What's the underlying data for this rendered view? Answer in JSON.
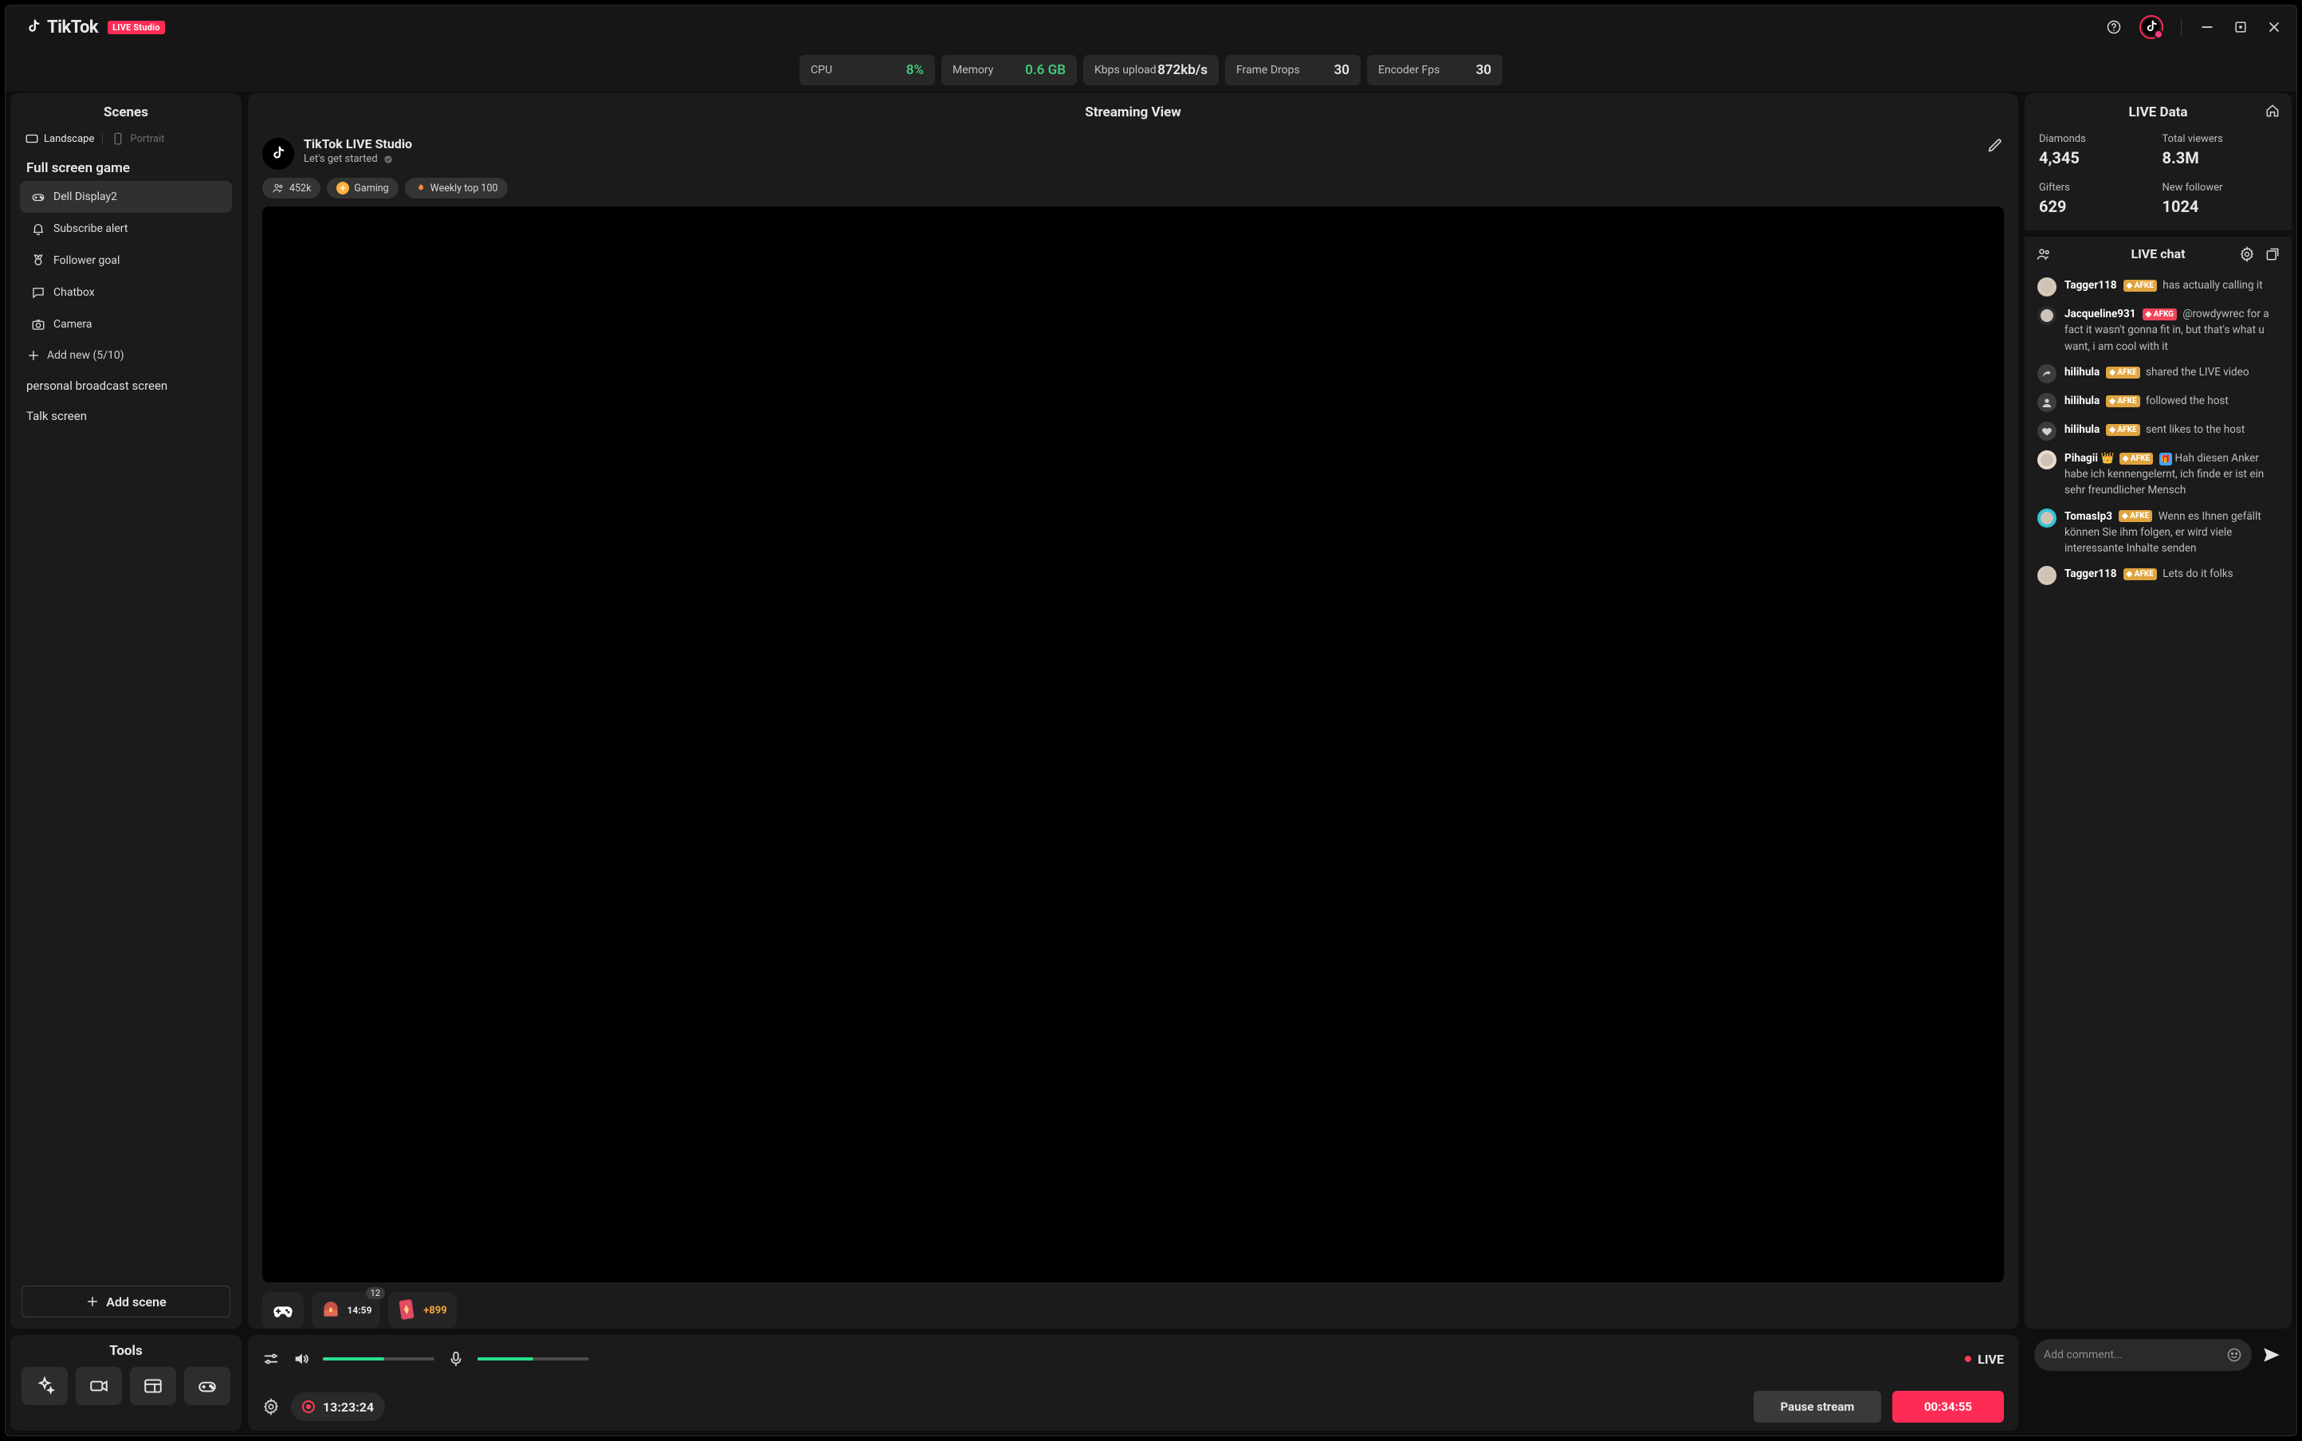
{
  "brand": {
    "name": "TikTok",
    "badge": "LIVE Studio"
  },
  "stats": {
    "cpu": {
      "label": "CPU",
      "value": "8%"
    },
    "memory": {
      "label": "Memory",
      "value": "0.6 GB"
    },
    "upload": {
      "label": "Kbps upload",
      "value": "872kb/s"
    },
    "drops": {
      "label": "Frame Drops",
      "value": "30"
    },
    "encoder": {
      "label": "Encoder Fps",
      "value": "30"
    }
  },
  "scenes": {
    "title": "Scenes",
    "orientation": {
      "landscape": "Landscape",
      "portrait": "Portrait"
    },
    "group": "Full screen game",
    "sources": [
      {
        "id": "dell",
        "label": "Dell Display2",
        "icon": "gamepad"
      },
      {
        "id": "sub",
        "label": "Subscribe alert",
        "icon": "bell"
      },
      {
        "id": "goal",
        "label": "Follower goal",
        "icon": "medal"
      },
      {
        "id": "chatbox",
        "label": "Chatbox",
        "icon": "chat"
      },
      {
        "id": "camera",
        "label": "Camera",
        "icon": "camera"
      }
    ],
    "add_new": "Add new (5/10)",
    "other": [
      "personal broadcast screen",
      "Talk screen"
    ],
    "add_scene": "Add scene"
  },
  "tools": {
    "title": "Tools"
  },
  "stream": {
    "title": "Streaming View",
    "room_title": "TikTok LIVE Studio",
    "room_sub": "Let's get started",
    "viewers": "452k",
    "chips": {
      "gaming": "Gaming",
      "weekly": "Weekly top 100"
    },
    "treasure": {
      "badge": "12",
      "time": "14:59"
    },
    "plus": "+899",
    "controls": {
      "live": "LIVE",
      "rec_elapsed": "13:23:24",
      "pause": "Pause stream",
      "live_timer": "00:34:55"
    }
  },
  "livedata": {
    "title": "LIVE Data",
    "metrics": [
      {
        "label": "Diamonds",
        "value": "4,345"
      },
      {
        "label": "Total viewers",
        "value": "8.3M"
      },
      {
        "label": "Gifters",
        "value": "629"
      },
      {
        "label": "New follower",
        "value": "1024"
      }
    ]
  },
  "chat": {
    "title": "LIVE chat",
    "input_placeholder": "Add comment...",
    "messages": [
      {
        "avatar": "user",
        "name": "Tagger118",
        "badge": "AFKE",
        "text": "has actually calling it"
      },
      {
        "avatar": "user",
        "name": "Jacqueline931",
        "badge": "AFKG",
        "badge_style": "red",
        "text": "@rowdywrec for a fact it wasn't gonna fit in, but that's what u want, i am cool with it"
      },
      {
        "avatar": "share",
        "name": "hilihula",
        "badge": "AFKE",
        "text": "shared the LIVE video"
      },
      {
        "avatar": "person",
        "name": "hilihula",
        "badge": "AFKE",
        "text": "followed the host"
      },
      {
        "avatar": "heart",
        "name": "hilihula",
        "badge": "AFKE",
        "text": "sent likes to the host"
      },
      {
        "avatar": "user",
        "name": "Pihagii",
        "badge": "AFKE",
        "gift": true,
        "text": "Hah diesen Anker habe ich kennengelernt, ich finde er ist ein sehr freundlicher Mensch"
      },
      {
        "avatar": "user",
        "name": "TomasIp3",
        "badge": "AFKE",
        "text": "Wenn es Ihnen gefällt können Sie ihm folgen, er wird viele interessante Inhalte senden"
      },
      {
        "avatar": "user",
        "name": "Tagger118",
        "badge": "AFKE",
        "text": "Lets do it folks"
      }
    ]
  }
}
